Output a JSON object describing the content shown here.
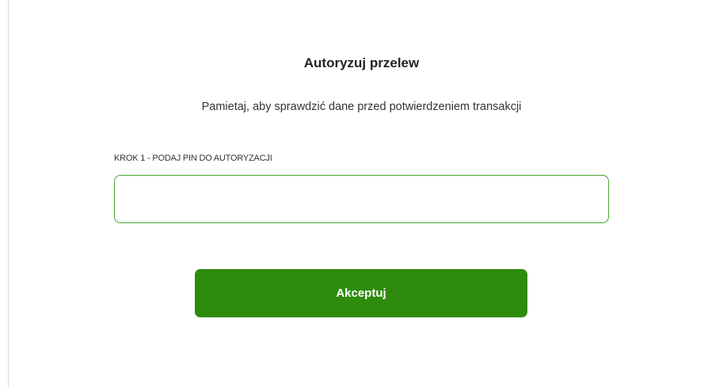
{
  "dialog": {
    "title": "Autoryzuj przelew",
    "subtitle": "Pamietaj, aby sprawdzić dane przed potwierdzeniem transakcji",
    "step_label": "KROK 1 - PODAJ PIN DO AUTORYZACJI",
    "pin_value": "",
    "accept_label": "Akceptuj"
  },
  "colors": {
    "input_border": "#4aa532",
    "button_background": "#2e8b0e",
    "button_text": "#ffffff"
  }
}
